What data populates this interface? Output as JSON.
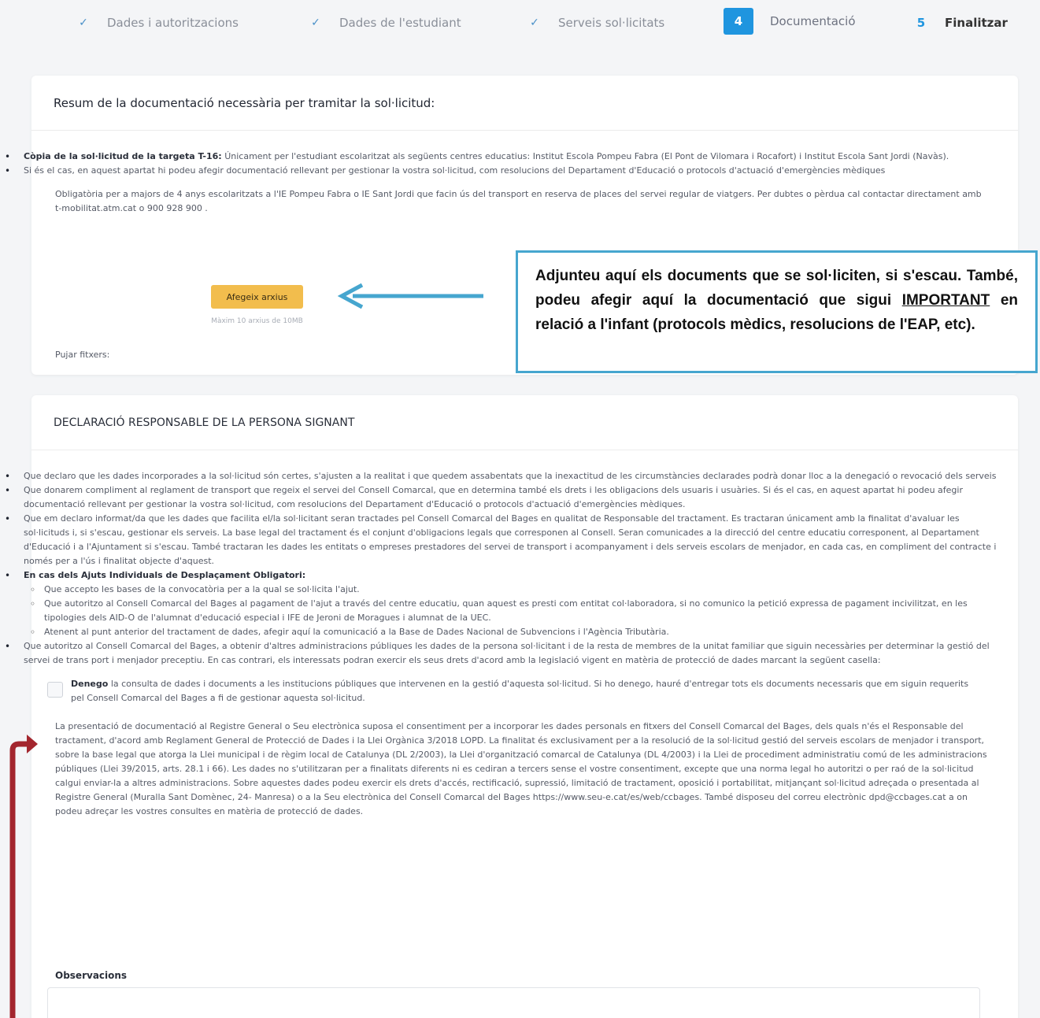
{
  "stepper": {
    "steps": [
      {
        "mark": "✓",
        "label": "Dades i autoritzacions",
        "state": "done"
      },
      {
        "mark": "✓",
        "label": "Dades de l'estudiant",
        "state": "done"
      },
      {
        "mark": "✓",
        "label": "Serveis sol·licitats",
        "state": "done"
      },
      {
        "mark": "4",
        "label": "Documentació",
        "state": "active"
      },
      {
        "mark": "5",
        "label": "Finalitzar",
        "state": "pending"
      }
    ]
  },
  "docs_card": {
    "title": "Resum de la documentació necessària per tramitar la sol·licitud:",
    "item1_lead": "Còpia de la sol·licitud de la targeta T-16:",
    "item1_text": " Únicament per l'estudiant escolaritzat als següents centres educatius: Institut Escola Pompeu Fabra (El Pont de Vilomara i Rocafort) i Institut Escola Sant Jordi (Navàs).",
    "item2_text": "Si és el cas, en aquest apartat hi podeu afegir documentació rellevant per gestionar la vostra sol·licitud, com resolucions del Departament d'Educació o protocols d'actuació d'emergències mèdiques",
    "obligatory_text": "Obligatòria per a majors de 4 anys escolaritzats a l'IE Pompeu Fabra o IE Sant Jordi que facin ús del transport en reserva de places del servei regular de viatgers. Per dubtes o pèrdua cal contactar directament amb t-mobilitat.atm.cat o 900 928 900 .",
    "upload_label": "Pujar fitxers:",
    "upload_button": "Afegeix arxius",
    "upload_hint": "Màxim 10 arxius de 10MB"
  },
  "annotation": {
    "text_before": "Adjunteu aquí els documents que se sol·liciten, si s'escau. També, podeu afegir aquí la documentació que sigui ",
    "text_underlined": "IMPORTANT",
    "text_after": " en relació a l'infant (protocols mèdics, resolucions de l'EAP, etc).",
    "arrow_color": "#46a6cf",
    "bracket_arrow_color": "#a3262e"
  },
  "declaration_card": {
    "title": "DECLARACIÓ RESPONSABLE DE LA PERSONA SIGNANT",
    "items": [
      "Que declaro que les dades incorporades a la sol·licitud són certes, s'ajusten a la realitat i que quedem assabentats que la inexactitud de les circumstàncies declarades podrà donar lloc a la denegació o revocació dels serveis",
      "Que donarem compliment al reglament de transport que regeix el servei del Consell Comarcal, que en determina també els drets i les obligacions dels usuaris i usuàries. Si és el cas, en aquest apartat hi podeu afegir documentació rellevant per gestionar la vostra sol·licitud, com resolucions del Departament d'Educació o protocols d'actuació d'emergències mèdiques.",
      "Que em declaro informat/da que les dades que facilita el/la sol·licitant seran tractades pel Consell Comarcal del Bages en qualitat de Responsable del tractament. Es tractaran únicament amb la finalitat d'avaluar les sol·licituds i, si s'escau, gestionar els serveis. La base legal del tractament és el conjunt d'obligacions legals que corresponen al Consell. Seran comunicades a la direcció del centre educatiu corresponent, al Departament d'Educació i a l'Ajuntament si s'escau. També tractaran les dades les entitats o empreses prestadores del servei de transport i acompanyament i dels serveis escolars de menjador, en cada cas, en compliment del contracte i només per a l'ús i finalitat objecte d'aquest."
    ],
    "ajuts_lead": "En cas dels Ajuts Individuals de Desplaçament Obligatori:",
    "ajuts_sub": [
      "Que accepto les bases de la convocatòria per a la qual se sol·licita l'ajut.",
      "Que autoritzo al Consell Comarcal del Bages al pagament de l'ajut a través del centre educatiu, quan aquest es presti com entitat col·laboradora, si no comunico la petició expressa de pagament incivilitzat, en les tipologies dels AID-O de l'alumnat d'educació especial i IFE de Jeroni de Moragues i alumnat de la UEC.",
      "Atenent al punt anterior del tractament de dades, afegir aquí la comunicació a la Base de Dades Nacional de Subvencions i l'Agència Tributària."
    ],
    "item_last": "Que autoritzo al Consell Comarcal del Bages, a obtenir d'altres administracions públiques les dades de la persona sol·licitant i de la resta de membres de la unitat familiar que siguin necessàries per determinar la gestió del servei de trans port i menjador preceptiu. En cas contrari, els interessats podran exercir els seus drets d'acord amb la legislació vigent en matèria de protecció de dades marcant la següent casella:",
    "denego_lead": "Denego",
    "denego_text": " la consulta de dades i documents a les institucions públiques que intervenen en la gestió d'aquesta sol·licitud. Si ho denego, hauré d'entregar tots els documents necessaris que em siguin requerits pel Consell Comarcal del Bages a fi de gestionar aquesta sol·licitud.",
    "privacy_text": "La presentació de documentació al Registre General o Seu electrònica suposa el consentiment per a incorporar les dades personals en fitxers del Consell Comarcal del Bages, dels quals n'és el Responsable del tractament, d'acord amb Reglament General de Protecció de Dades i la Llei Orgànica 3/2018 LOPD. La finalitat és exclusivament per a la resolució de la sol·licitud gestió del serveis escolars de menjador i transport, sobre la base legal que atorga la Llei municipal i de règim local de Catalunya (DL 2/2003), la Llei d'organització comarcal de Catalunya (DL 4/2003) i la Llei de procediment administratiu comú de les administracions públiques (Llei 39/2015, arts. 28.1 i 66). Les dades no s'utilitzaran per a finalitats diferents ni es cediran a tercers sense el vostre consentiment, excepte que una norma legal ho autoritzi o per raó de la sol·licitud calgui enviar-la a altres administracions. Sobre aquestes dades podeu exercir els drets d'accés, rectificació, supressió, limitació de tractament, oposició i portabilitat, mitjançant sol·licitud adreçada o presentada al Registre General (Muralla Sant Domènec, 24- Manresa) o a la Seu electrònica del Consell Comarcal del Bages https://www.seu-e.cat/es/web/ccbages. També disposeu del correu electrònic dpd@ccbages.cat a on podeu adreçar les vostres consultes en matèria de protecció de dades.",
    "observations_label": "Observacions",
    "observations_value": ""
  }
}
